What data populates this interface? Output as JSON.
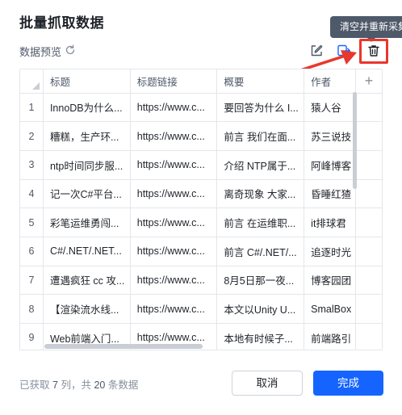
{
  "dialog": {
    "title": "批量抓取数据",
    "tooltip": "清空并重新采集",
    "preview_label": "数据预览"
  },
  "icons": {
    "refresh": "refresh-icon",
    "edit": "edit-icon",
    "export": "export-icon",
    "delete": "trash-icon"
  },
  "table": {
    "columns": [
      "标题",
      "标题链接",
      "概要",
      "作者"
    ],
    "add_column": "+",
    "rows": [
      {
        "n": "1",
        "c1": "InnoDB为什么...",
        "c2": "https://www.c...",
        "c3": "要回答为什么 I...",
        "c4": "猿人谷"
      },
      {
        "n": "2",
        "c1": "糟糕，生产环...",
        "c2": "https://www.c...",
        "c3": "前言 我们在面...",
        "c4": "苏三说技"
      },
      {
        "n": "3",
        "c1": "ntp时间同步服...",
        "c2": "https://www.c...",
        "c3": "介绍 NTP属于...",
        "c4": "阿峰博客"
      },
      {
        "n": "4",
        "c1": "记一次C#平台...",
        "c2": "https://www.c...",
        "c3": "离奇现象 大家...",
        "c4": "昏睡红猹"
      },
      {
        "n": "5",
        "c1": "彩笔运维勇闯...",
        "c2": "https://www.c...",
        "c3": "前言 在运维职...",
        "c4": "it排球君"
      },
      {
        "n": "6",
        "c1": "C#/.NET/.NET...",
        "c2": "https://www.c...",
        "c3": "前言 C#/.NET/...",
        "c4": "追逐时光"
      },
      {
        "n": "7",
        "c1": "遭遇疯狂 cc 攻...",
        "c2": "https://www.c...",
        "c3": "8月5日那一夜...",
        "c4": "博客园团"
      },
      {
        "n": "8",
        "c1": "【渲染流水线...",
        "c2": "https://www.c...",
        "c3": "本文以Unity U...",
        "c4": "SmalBox"
      },
      {
        "n": "9",
        "c1": "Web前端入门...",
        "c2": "https://www.c...",
        "c3": "本地有时候子...",
        "c4": "前端路引"
      }
    ]
  },
  "footer": {
    "status_prefix": "已获取",
    "columns_count": "7",
    "status_mid": "列，共",
    "rows_count": "20",
    "status_suffix": "条数据",
    "cancel_label": "取消",
    "done_label": "完成"
  },
  "colors": {
    "primary": "#1664ff",
    "annotation": "#e8382c",
    "tooltip_bg": "#4e5969"
  }
}
